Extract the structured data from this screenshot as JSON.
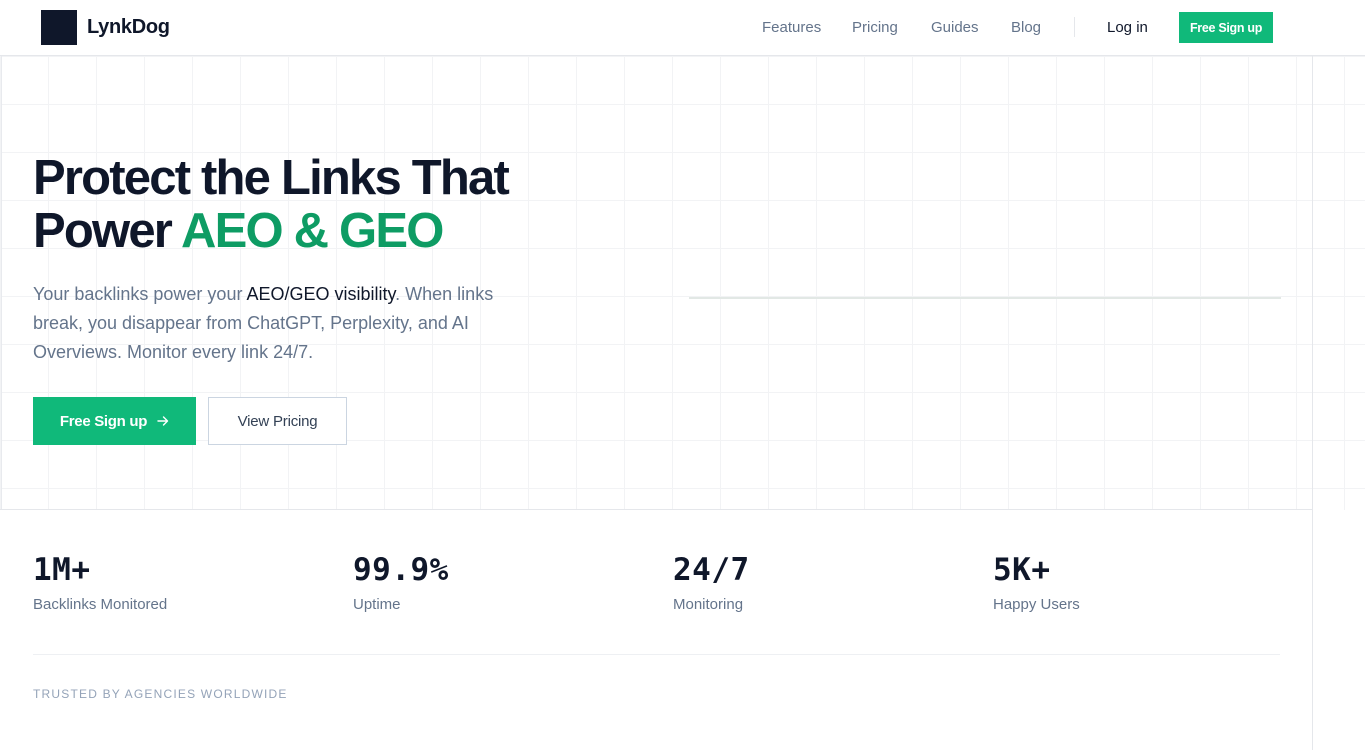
{
  "brand": {
    "name": "LynkDog"
  },
  "nav": {
    "items": [
      {
        "label": "Features"
      },
      {
        "label": "Pricing"
      },
      {
        "label": "Guides"
      },
      {
        "label": "Blog"
      }
    ],
    "login_label": "Log in",
    "signup_label": "Free Sign up"
  },
  "hero": {
    "title_line1": "Protect the Links That",
    "title_line2_plain": "Power ",
    "title_line2_accent": "AEO & GEO",
    "subtitle_part1": "Your backlinks power your ",
    "subtitle_strong": "AEO/GEO visibility",
    "subtitle_part2": ". When links break, you disappear from ChatGPT, Perplexity, and AI Overviews. Monitor every link 24/7.",
    "primary_cta": "Free Sign up",
    "secondary_cta": "View Pricing"
  },
  "stats": [
    {
      "value": "1M+",
      "label": "Backlinks Monitored"
    },
    {
      "value": "99.9%",
      "label": "Uptime"
    },
    {
      "value": "24/7",
      "label": "Monitoring"
    },
    {
      "value": "5K+",
      "label": "Happy Users"
    }
  ],
  "trusted": {
    "label": "TRUSTED BY AGENCIES WORLDWIDE"
  },
  "colors": {
    "accent": "#10b97a",
    "accent_text": "#0e9c64",
    "heading": "#0f172a",
    "muted": "#64748b"
  },
  "icons": {
    "cta_arrow": "arrow-right-icon"
  }
}
